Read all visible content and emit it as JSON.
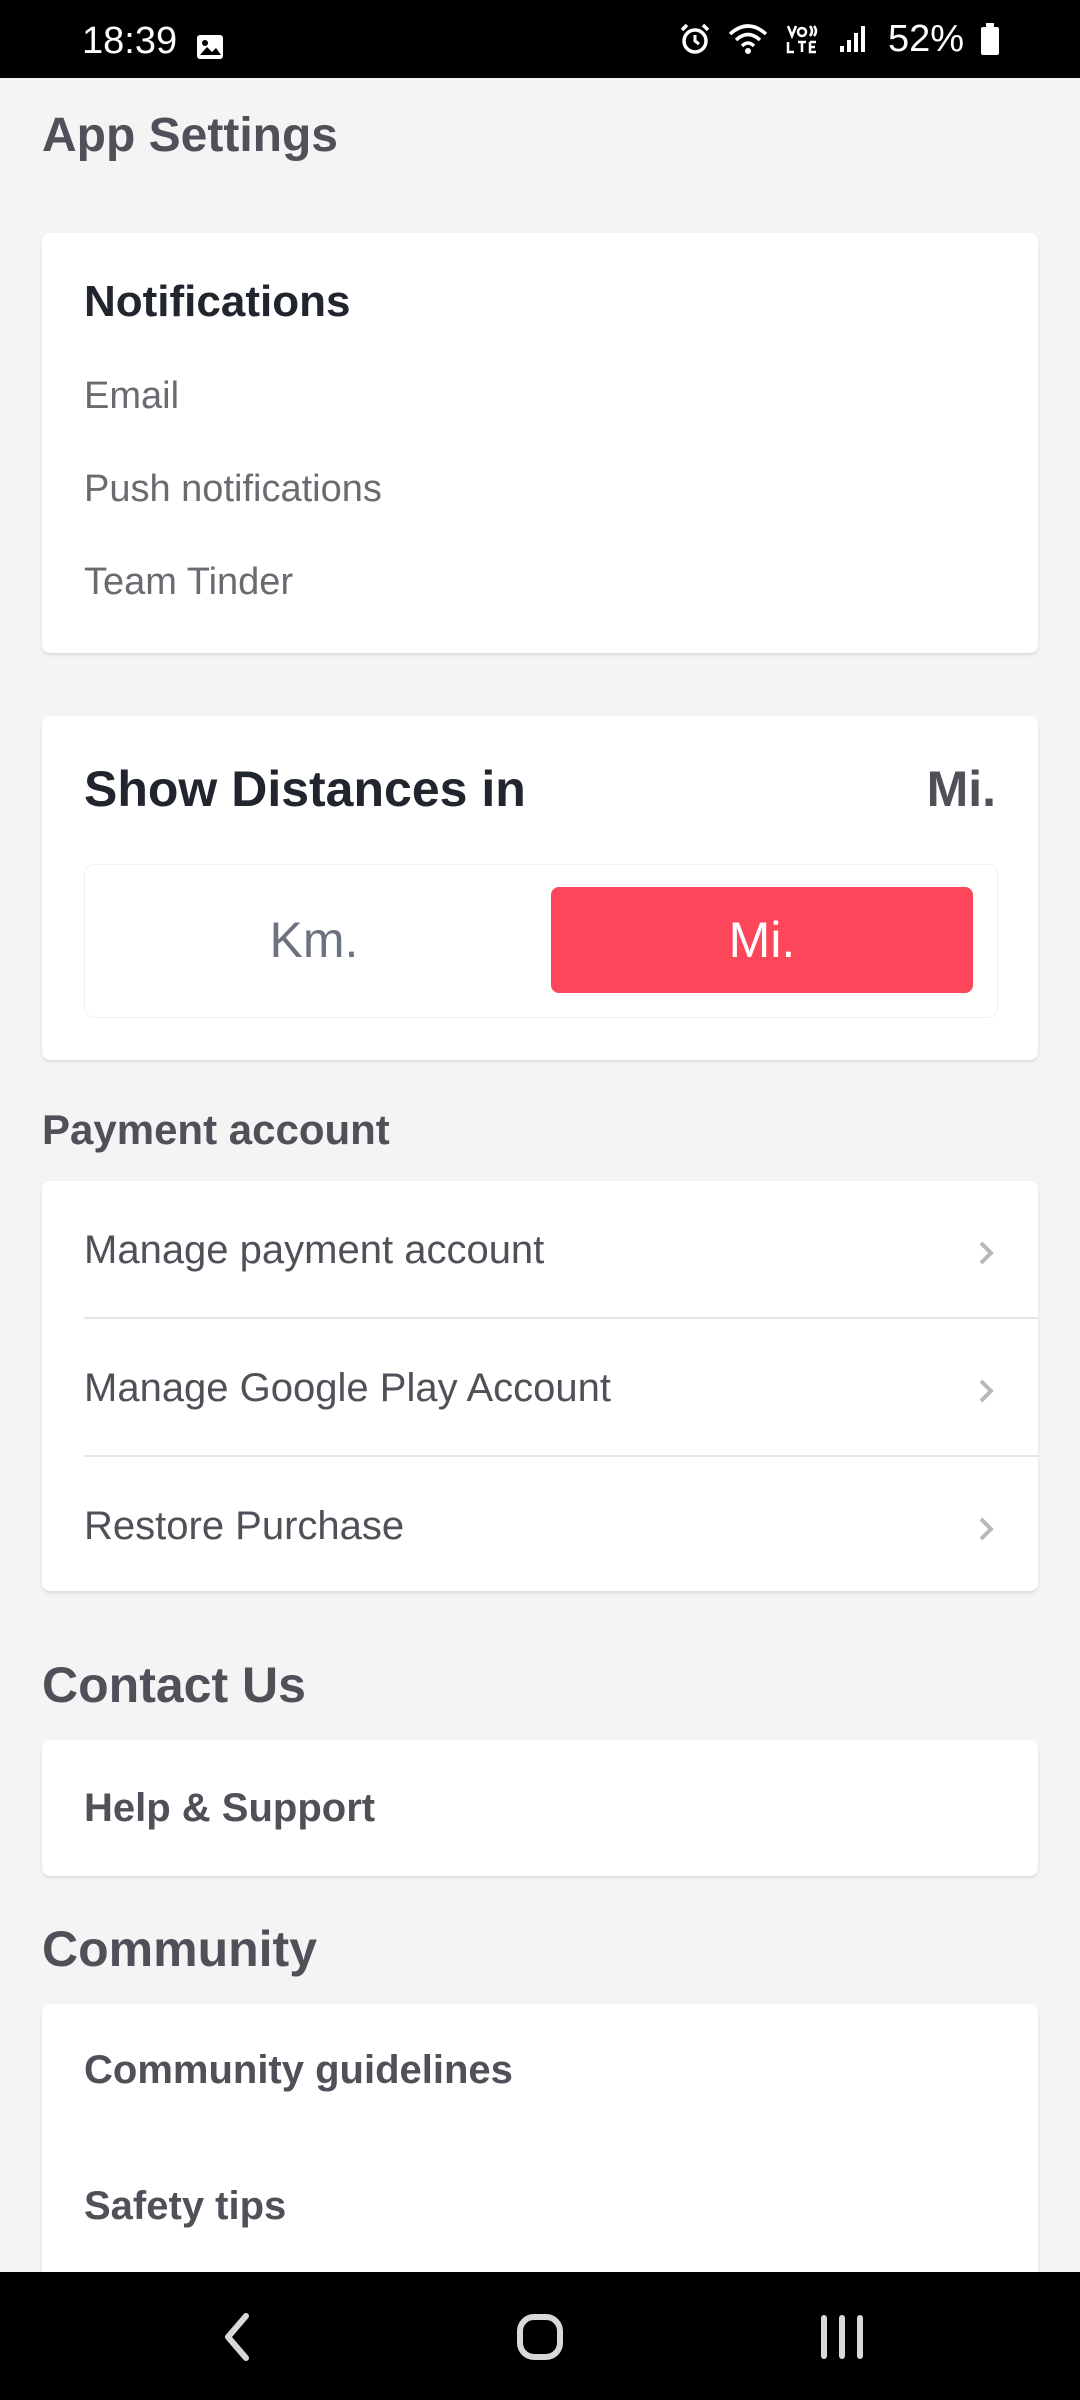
{
  "status_bar": {
    "time": "18:39",
    "battery": "52%",
    "icons": [
      "image-icon",
      "alarm-icon",
      "wifi-icon",
      "volte-icon",
      "signal-icon",
      "battery-icon"
    ]
  },
  "page": {
    "title": "App Settings"
  },
  "notifications": {
    "title": "Notifications",
    "items": [
      "Email",
      "Push notifications",
      "Team Tinder"
    ]
  },
  "distance": {
    "title": "Show Distances in",
    "current_value": "Mi.",
    "options": [
      "Km.",
      "Mi."
    ],
    "selected": "Mi.",
    "accent_color": "#fd4659"
  },
  "payment": {
    "label": "Payment account",
    "items": [
      "Manage payment account",
      "Manage Google Play Account",
      "Restore Purchase"
    ]
  },
  "contact": {
    "label": "Contact Us",
    "items": [
      "Help & Support"
    ]
  },
  "community": {
    "label": "Community",
    "items": [
      "Community guidelines",
      "Safety tips"
    ]
  },
  "nav_bar": {
    "icons": [
      "back-icon",
      "home-icon",
      "recents-icon"
    ]
  }
}
